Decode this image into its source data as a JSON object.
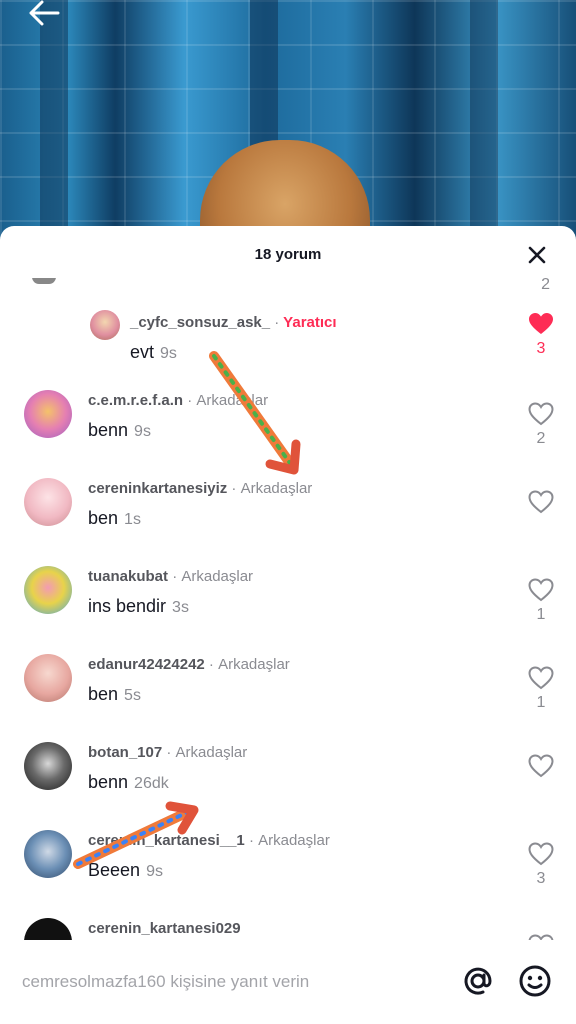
{
  "header": {
    "back_icon": "arrow-left-icon"
  },
  "sheet": {
    "title": "18 yorum",
    "close_icon": "close-icon"
  },
  "cut_top": {
    "count": "2"
  },
  "comments": [
    {
      "user": "_cyfc_sonsuz_ask_",
      "tag": "Yaratıcı",
      "text": "evt",
      "time": "9s",
      "likes": "3",
      "liked": true
    },
    {
      "user": "c.e.m.r.e.f.a.n",
      "tag": "Arkadaşlar",
      "text": "benn",
      "time": "9s",
      "likes": "2"
    },
    {
      "user": "cereninkartanesiyiz",
      "tag": "Arkadaşlar",
      "text": "ben",
      "time": "1s",
      "likes": ""
    },
    {
      "user": "tuanakubat",
      "tag": "Arkadaşlar",
      "text": "ins bendir",
      "time": "3s",
      "likes": "1"
    },
    {
      "user": "edanur42424242",
      "tag": "Arkadaşlar",
      "text": "ben",
      "time": "5s",
      "likes": "1"
    },
    {
      "user": "botan_107",
      "tag": "Arkadaşlar",
      "text": "benn",
      "time": "26dk",
      "likes": ""
    },
    {
      "user": "ceremin_kartanesi__1",
      "tag": "Arkadaşlar",
      "text": "Beeen",
      "time": "9s",
      "likes": "3"
    },
    {
      "user": "cerenin_kartanesi029",
      "tag": "",
      "text": "",
      "time": "",
      "likes": ""
    }
  ],
  "reply": {
    "placeholder": "cemresolmazfa160 kişisine yanıt verin",
    "at_icon": "at-icon",
    "emoji_icon": "emoji-icon"
  },
  "colors": {
    "accent": "#fe2c55",
    "text": "#161823",
    "muted": "#8a8b91"
  }
}
